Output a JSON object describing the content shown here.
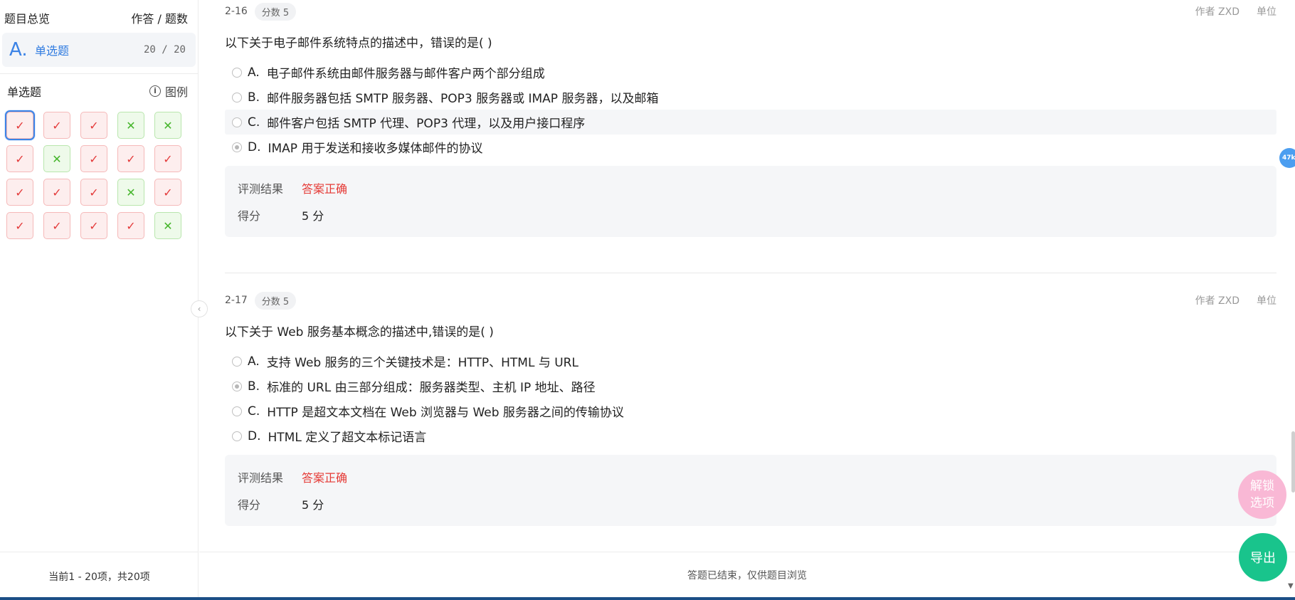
{
  "sidebar": {
    "overview_title": "题目总览",
    "overview_right": "作答 / 题数",
    "category": {
      "glyph": "A.",
      "name": "单选题",
      "count": "20 / 20"
    },
    "section_title": "单选题",
    "legend_label": "图例",
    "legend_icon": "info-icon",
    "cells": [
      {
        "status": "right",
        "mark": "✓",
        "current": true
      },
      {
        "status": "right",
        "mark": "✓"
      },
      {
        "status": "right",
        "mark": "✓"
      },
      {
        "status": "wrong",
        "mark": "✕"
      },
      {
        "status": "wrong",
        "mark": "✕"
      },
      {
        "status": "right",
        "mark": "✓"
      },
      {
        "status": "wrong",
        "mark": "✕"
      },
      {
        "status": "right",
        "mark": "✓"
      },
      {
        "status": "right",
        "mark": "✓"
      },
      {
        "status": "right",
        "mark": "✓"
      },
      {
        "status": "right",
        "mark": "✓"
      },
      {
        "status": "right",
        "mark": "✓"
      },
      {
        "status": "right",
        "mark": "✓"
      },
      {
        "status": "wrong",
        "mark": "✕"
      },
      {
        "status": "right",
        "mark": "✓"
      },
      {
        "status": "right",
        "mark": "✓"
      },
      {
        "status": "right",
        "mark": "✓"
      },
      {
        "status": "right",
        "mark": "✓"
      },
      {
        "status": "right",
        "mark": "✓"
      },
      {
        "status": "wrong",
        "mark": "✕"
      }
    ],
    "footer": "当前1 - 20项，共20项",
    "collapse_icon": "‹"
  },
  "questions": [
    {
      "num": "2-16",
      "score_badge": "分数 5",
      "author": "作者 ZXD",
      "unit": "单位",
      "title": "以下关于电子邮件系统特点的描述中，错误的是(    )",
      "options": [
        {
          "letter": "A.",
          "text": "电子邮件系统由邮件服务器与邮件客户两个部分组成",
          "checked": false
        },
        {
          "letter": "B.",
          "text": "邮件服务器包括 SMTP 服务器、POP3 服务器或 IMAP 服务器，以及邮箱",
          "checked": false
        },
        {
          "letter": "C.",
          "text": "邮件客户包括 SMTP 代理、POP3 代理，以及用户接口程序",
          "checked": false
        },
        {
          "letter": "D.",
          "text": "IMAP 用于发送和接收多媒体邮件的协议",
          "checked": true
        }
      ],
      "result_label": "评测结果",
      "result_value": "答案正确",
      "score_label": "得分",
      "score_value": "5 分"
    },
    {
      "num": "2-17",
      "score_badge": "分数 5",
      "author": "作者 ZXD",
      "unit": "单位",
      "title": "以下关于 Web 服务基本概念的描述中,错误的是(    )",
      "options": [
        {
          "letter": "A.",
          "text": "支持 Web 服务的三个关键技术是：HTTP、HTML 与 URL",
          "checked": false
        },
        {
          "letter": "B.",
          "text": "标准的 URL 由三部分组成：服务器类型、主机 IP 地址、路径",
          "checked": true
        },
        {
          "letter": "C.",
          "text": "HTTP 是超文本文档在 Web 浏览器与 Web 服务器之间的传输协议",
          "checked": false
        },
        {
          "letter": "D.",
          "text": "HTML 定义了超文本标记语言",
          "checked": false
        }
      ],
      "result_label": "评测结果",
      "result_value": "答案正确",
      "score_label": "得分",
      "score_value": "5 分"
    }
  ],
  "main_footer": "答题已结束，仅供题目浏览",
  "floating": {
    "side_pill": "47k",
    "unlock_line1": "解锁",
    "unlock_line2": "选项",
    "export": "导出"
  },
  "colors": {
    "accent_blue": "#3b83e6",
    "correct_red": "#e53935",
    "wrong_green": "#45b52b",
    "export_green": "#19c48c",
    "unlock_pink": "#f9b8d5"
  }
}
